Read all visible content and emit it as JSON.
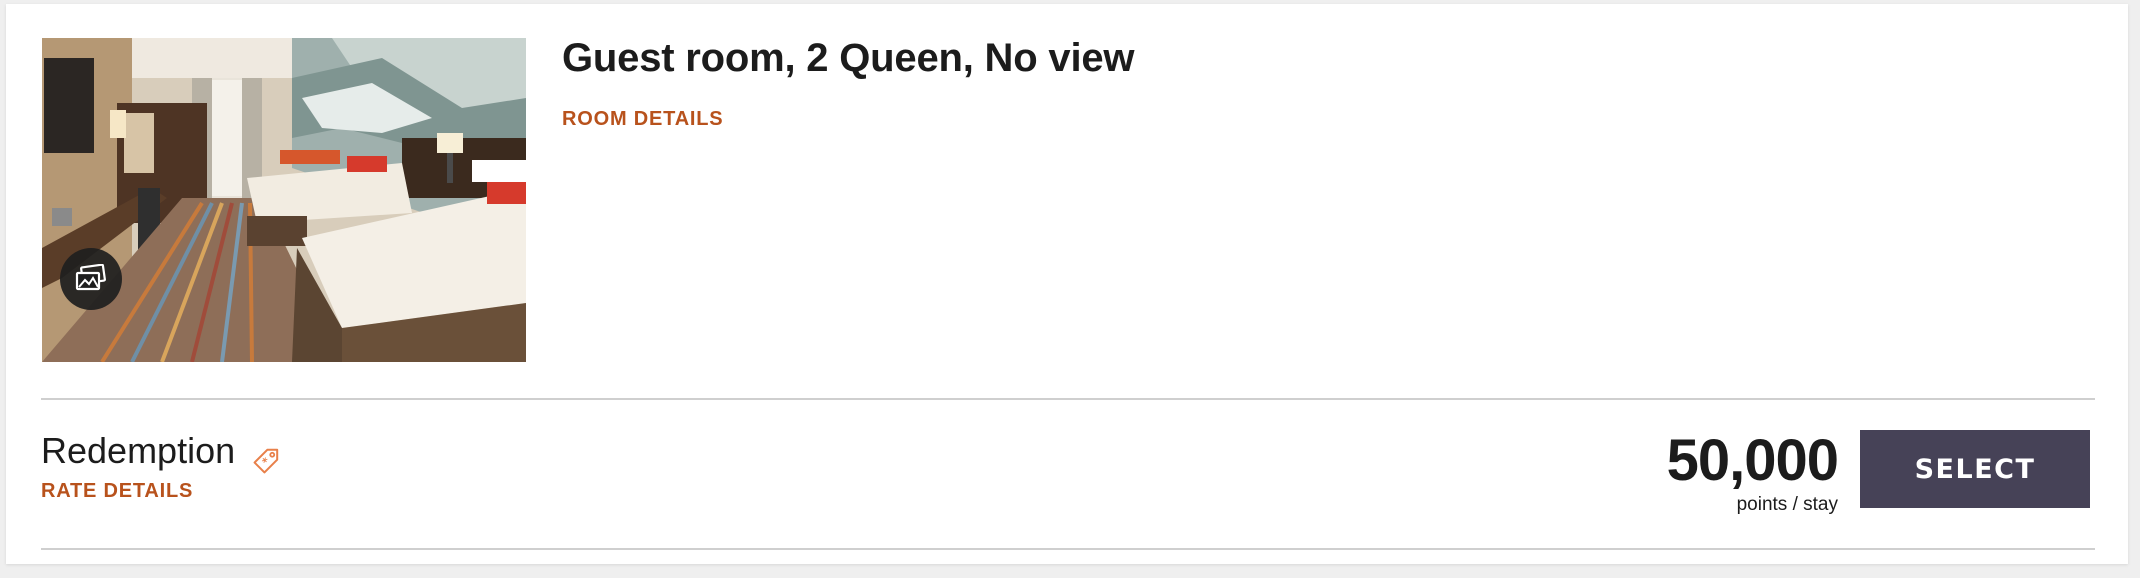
{
  "room": {
    "title": "Guest room, 2 Queen, No view",
    "details_link": "ROOM DETAILS",
    "photo_alt": "Guest room with two queen beds",
    "gallery_icon": "image-gallery-icon"
  },
  "rate": {
    "name": "Redemption",
    "details_link": "RATE DETAILS",
    "tag_icon": "price-tag-icon"
  },
  "price": {
    "value": "50,000",
    "unit": "points / stay"
  },
  "actions": {
    "select_label": "SELECT"
  },
  "colors": {
    "accent_link": "#b8521c",
    "button_bg": "#464257",
    "divider": "#cfcfcf",
    "tag_icon": "#e8804a"
  }
}
